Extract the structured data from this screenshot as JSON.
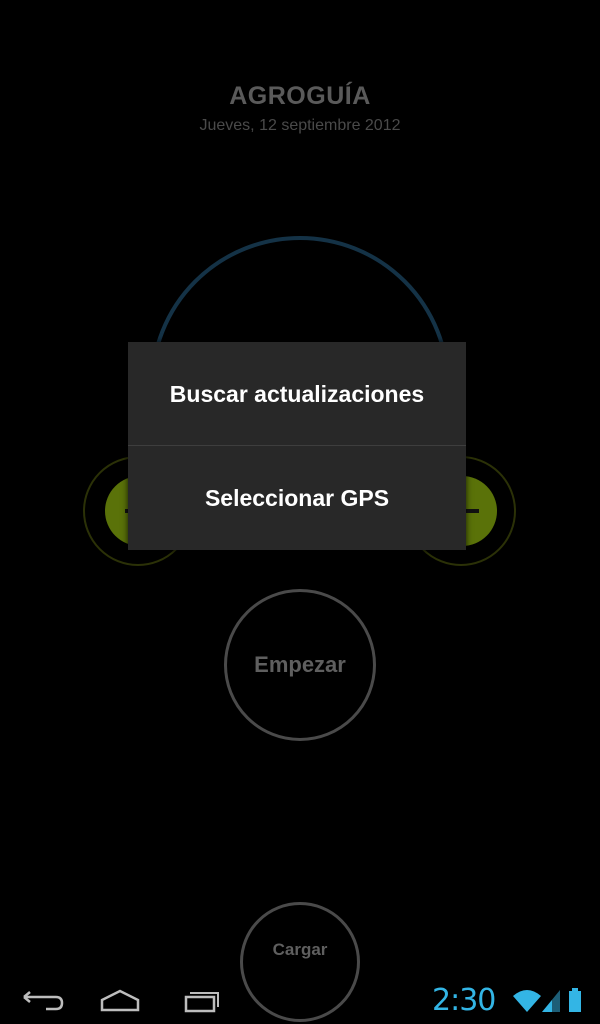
{
  "app": {
    "title": "AGROGUÍA",
    "date": "Jueves, 12 septiembre 2012"
  },
  "main": {
    "start_label": "Empezar",
    "load_label": "Cargar"
  },
  "dialog": {
    "items": [
      {
        "label": "Buscar actualizaciones"
      },
      {
        "label": "Seleccionar GPS"
      }
    ]
  },
  "status_bar": {
    "clock": "2:30",
    "accent_color": "#33b5e5",
    "icons": [
      "wifi-icon",
      "signal-icon",
      "battery-icon"
    ]
  },
  "nav_bar": {
    "buttons": [
      "back-icon",
      "home-icon",
      "recent-apps-icon"
    ]
  },
  "colors": {
    "background": "#000000",
    "dial_ring": "#143246",
    "knob_green": "#5a7209",
    "dialog_bg": "#282828",
    "dialog_text": "#ffffff"
  }
}
